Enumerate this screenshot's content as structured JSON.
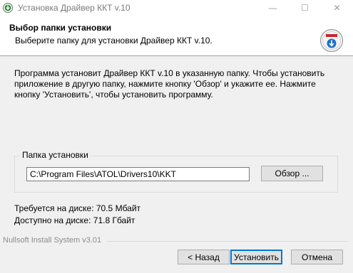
{
  "window": {
    "title": "Установка Драйвер ККТ v.10",
    "controls": {
      "minimize": "—",
      "maximize": "☐",
      "close": "✕"
    },
    "icon": "installer-icon"
  },
  "header": {
    "title": "Выбор папки установки",
    "subtitle": "Выберите папку для установки Драйвер ККТ v.10.",
    "logo": "installer-logo-icon"
  },
  "main": {
    "intro": "Программа установит Драйвер ККТ v.10 в указанную папку. Чтобы установить приложение в другую папку, нажмите кнопку 'Обзор' и укажите ее. Нажмите кнопку 'Установить', чтобы установить программу.",
    "folder_group_label": "Папка установки",
    "folder_path": "C:\\Program Files\\ATOL\\Drivers10\\KKT",
    "browse_label": "Обзор ...",
    "space_required": "Требуется на диске: 70.5 Мбайт",
    "space_available": "Доступно на диске: 71.8 Гбайт"
  },
  "footer": {
    "brand": "Nullsoft Install System v3.01",
    "back_label": "< Назад",
    "install_label": "Установить",
    "cancel_label": "Отмена"
  },
  "colors": {
    "accent": "#0078d7",
    "background": "#f0f0f0",
    "header_bg": "#ffffff"
  }
}
